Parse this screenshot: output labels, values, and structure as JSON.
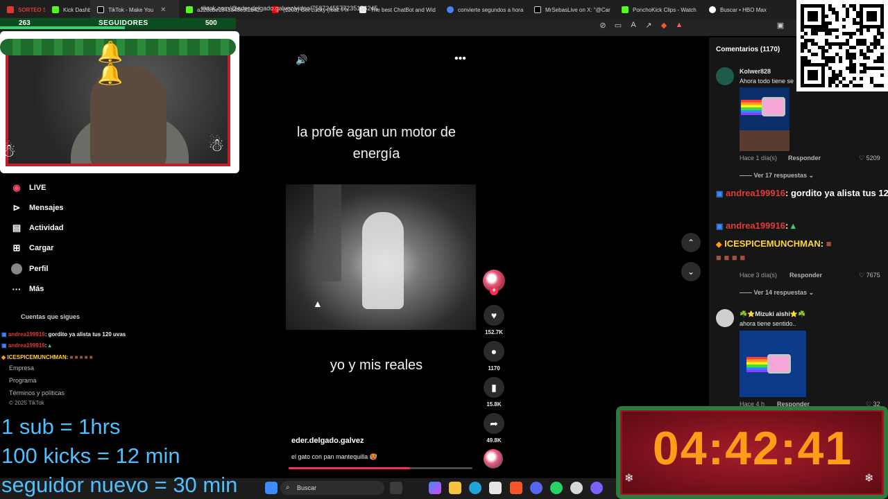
{
  "browser": {
    "tabs": [
      {
        "label": "SORTEO STEAM MACHINE",
        "icon": "kick-icon",
        "color": "#e0382b"
      },
      {
        "label": "Kick Dashbo",
        "icon": "kick-icon",
        "color": "#53fc18"
      },
      {
        "label": "TikTok - Make You",
        "icon": "tiktok-icon",
        "color": "#ffffff",
        "active": true
      },
      {
        "label": "a228cbe1843848e9f2b42",
        "icon": "page-icon",
        "color": "#53fc18"
      },
      {
        "label": "(1208) Get Lucky (feat. Ph",
        "icon": "youtube-icon",
        "color": "#ff0000"
      },
      {
        "label": "The best ChatBot and Wid",
        "icon": "bot-icon",
        "color": "#ffffff"
      },
      {
        "label": "convierte segundos a hora",
        "icon": "google-icon",
        "color": "#4285f4"
      },
      {
        "label": "MrSebasLive on X: \"@Car",
        "icon": "x-icon",
        "color": "#ffffff"
      },
      {
        "label": "PonchoKick Clips - Watch",
        "icon": "kick-icon",
        "color": "#53fc18"
      },
      {
        "label": "Buscar • HBO Max",
        "icon": "hbo-icon",
        "color": "#ffffff"
      }
    ],
    "url": "tiktok.com/@eder.delgado.galvez/video/7587245577235156245"
  },
  "overlay": {
    "counter_left": "263",
    "counter_label": "SEGUIDORES",
    "counter_right": "500",
    "counter_progress": 0.53,
    "rules": [
      "1 sub = 1hrs",
      "100 kicks = 12 min",
      "seguidor nuevo = 30 min"
    ],
    "timer": "04:42:41",
    "chat": [
      {
        "user": "andrea199916",
        "text": ": gordito ya alista tus 120 uvas"
      },
      {
        "user": "andrea199916",
        "text": ":"
      },
      {
        "user": "ICESPICEMUNCHMAN",
        "text": ":"
      }
    ]
  },
  "sidebar": {
    "items": [
      {
        "label": "LIVE",
        "icon": "live-icon"
      },
      {
        "label": "Mensajes",
        "icon": "send-icon"
      },
      {
        "label": "Actividad",
        "icon": "activity-icon"
      },
      {
        "label": "Cargar",
        "icon": "upload-icon"
      },
      {
        "label": "Perfil",
        "icon": "profile-icon"
      },
      {
        "label": "Más",
        "icon": "more-icon"
      }
    ],
    "section_title": "Cuentas que sigues",
    "links": [
      "Empresa",
      "Programa",
      "Términos y políticas"
    ],
    "copyright": "© 2025 TikTok"
  },
  "video": {
    "caption_top": "la profe agan un motor de energía",
    "caption_bottom": "yo y mis reales",
    "author": "eder.delgado.galvez",
    "description": "el gato con pan mantequilla 🥵",
    "progress": 0.66,
    "likes": "152.7K",
    "comments": "1170",
    "saves": "15.8K",
    "shares": "49.8K"
  },
  "comments": {
    "title": "Comentarios (1170)",
    "items": [
      {
        "user": "Kolwer828",
        "text": "Ahora todo tiene se",
        "meta": "Hace 1 día(s)",
        "reply": "Responder",
        "likes": "5209",
        "more": "Ver 17 respuestas"
      },
      {
        "user": "",
        "text": "",
        "meta": "Hace 3 día(s)",
        "reply": "Responder",
        "likes": "7675",
        "more": "Ver 14 respuestas"
      },
      {
        "user": "☘️⭐Mizuki aishi⭐☘️",
        "text": "ahora tiene sentido..",
        "meta": "Hace 4 h",
        "reply": "Responder",
        "likes": "32",
        "more": ""
      }
    ],
    "overlay_chat": [
      {
        "user": "andrea199916",
        "text": ": gordito ya alista tus 120 uvas"
      },
      {
        "user": "andrea199916",
        "text": ":"
      },
      {
        "user": "ICESPICEMUNCHMAN",
        "text": ":"
      }
    ]
  },
  "taskbar": {
    "search_placeholder": "Buscar"
  }
}
